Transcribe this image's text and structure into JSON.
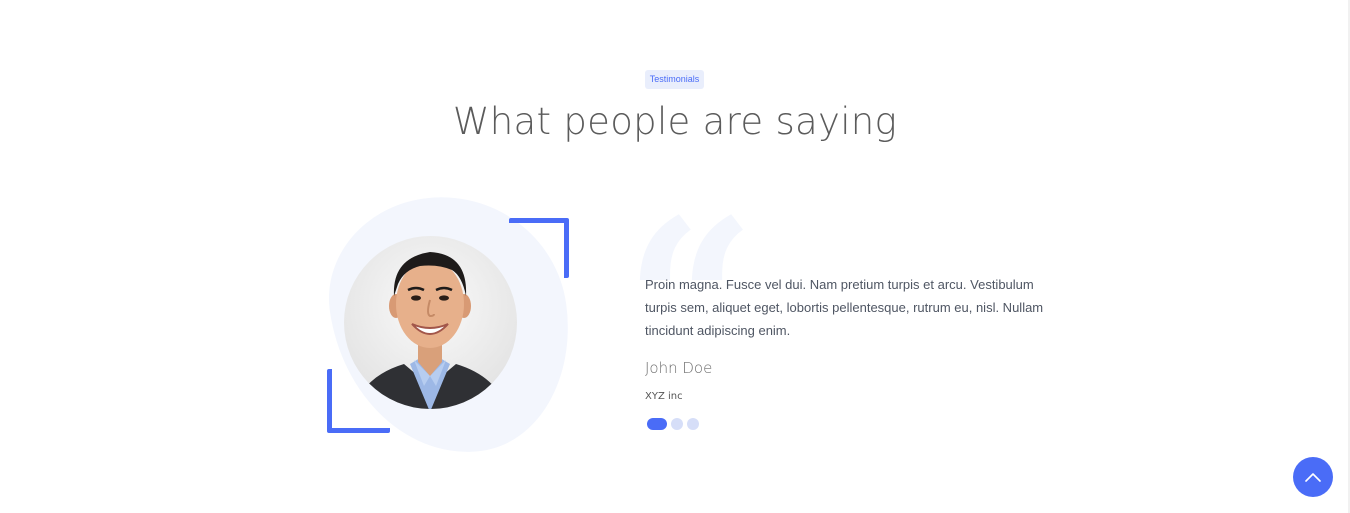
{
  "section": {
    "badge": "Testimonials",
    "heading": "What people are saying"
  },
  "testimonial": {
    "quote": "Proin magna. Fusce vel dui. Nam pretium turpis et arcu. Vestibulum turpis sem, aliquet eget, lobortis pellentesque, rutrum eu, nisl. Nullam tincidunt adipiscing enim.",
    "author": "John Doe",
    "company": "XYZ inc",
    "quote_mark": "“"
  },
  "slider": {
    "active_index": 0,
    "count": 3
  },
  "colors": {
    "accent": "#4a6cf7",
    "badge_bg": "#e9eefc",
    "blob": "#f3f6fd",
    "dot_inactive": "#d6def8",
    "heading": "#5b5b5b"
  },
  "icons": {
    "back_to_top": "chevron-up-icon"
  }
}
